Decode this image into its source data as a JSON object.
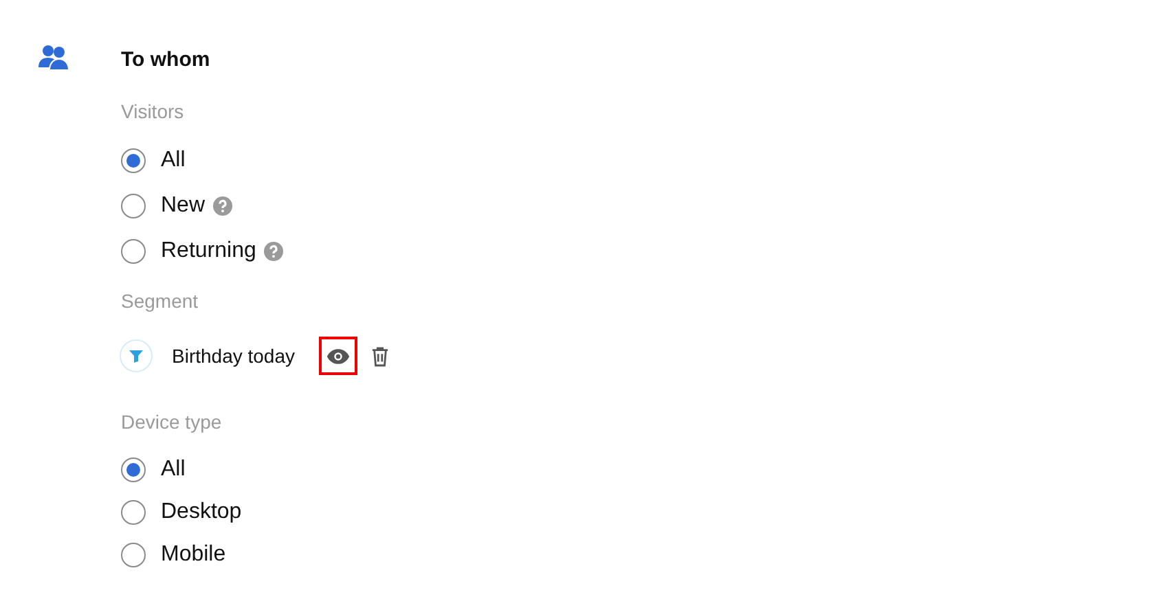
{
  "title": "To whom",
  "sections": [
    {
      "kind": "radio",
      "label": "Visitors",
      "options": [
        {
          "label": "All",
          "selected": true,
          "help": false
        },
        {
          "label": "New",
          "selected": false,
          "help": true
        },
        {
          "label": "Returning",
          "selected": false,
          "help": true
        }
      ]
    },
    {
      "kind": "segment",
      "label": "Segment",
      "segment": {
        "name": "Birthday today",
        "view_highlighted": true
      }
    },
    {
      "kind": "radio",
      "label": "Device type",
      "options": [
        {
          "label": "All",
          "selected": true,
          "help": false
        },
        {
          "label": "Desktop",
          "selected": false,
          "help": false
        },
        {
          "label": "Mobile",
          "selected": false,
          "help": false
        }
      ]
    }
  ]
}
